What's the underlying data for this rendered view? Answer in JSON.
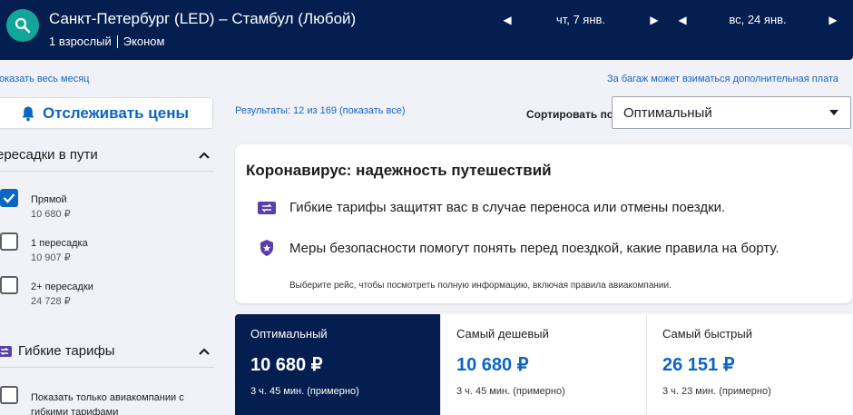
{
  "header": {
    "route": "Санкт-Петербург (LED) – Стамбул (Любой)",
    "passengers": "1 взрослый",
    "cabin": "Эконом",
    "depart_date": "чт, 7 янв.",
    "return_date": "вс, 24 янв."
  },
  "links": {
    "whole_month": "оказать весь месяц",
    "baggage_note": "За багаж может взиматься дополнительная плата"
  },
  "track_prices": "Отслеживать цены",
  "results": {
    "summary": "Результаты: 12 из 169 (показать все)",
    "sort_label": "Сортировать по",
    "sort_value": "Оптимальный"
  },
  "filters": {
    "stops_title": "ересадки в пути",
    "options": [
      {
        "label": "Прямой",
        "price": "10 680 ₽",
        "checked": true
      },
      {
        "label": "1 пересадка",
        "price": "10 907 ₽",
        "checked": false
      },
      {
        "label": "2+ пересадки",
        "price": "24 728 ₽",
        "checked": false
      }
    ],
    "flex_title": "Гибкие тарифы",
    "flex_option": "Показать только авиакомпании с",
    "flex_option_cont": "гибкими тарифами"
  },
  "corona": {
    "title": "Коронавирус: надежность путешествий",
    "row1": "Гибкие тарифы защитят вас в случае переноса или отмены поездки.",
    "row2": "Меры безопасности помогут понять перед поездкой, какие правила на борту.",
    "note": "Выберите рейс, чтобы посмотреть полную информацию, включая правила авиакомпании."
  },
  "tabs": [
    {
      "name": "Оптимальный",
      "price": "10 680 ₽",
      "duration": "3 ч. 45 мин. (примерно)"
    },
    {
      "name": "Самый дешевый",
      "price": "10 680 ₽",
      "duration": "3 ч. 45 мин. (примерно)"
    },
    {
      "name": "Самый быстрый",
      "price": "26 151 ₽",
      "duration": "3 ч. 23 мин. (примерно)"
    }
  ],
  "colors": {
    "header_bg": "#041e4f",
    "accent": "#0b65c2",
    "search_button": "#12a59a"
  }
}
